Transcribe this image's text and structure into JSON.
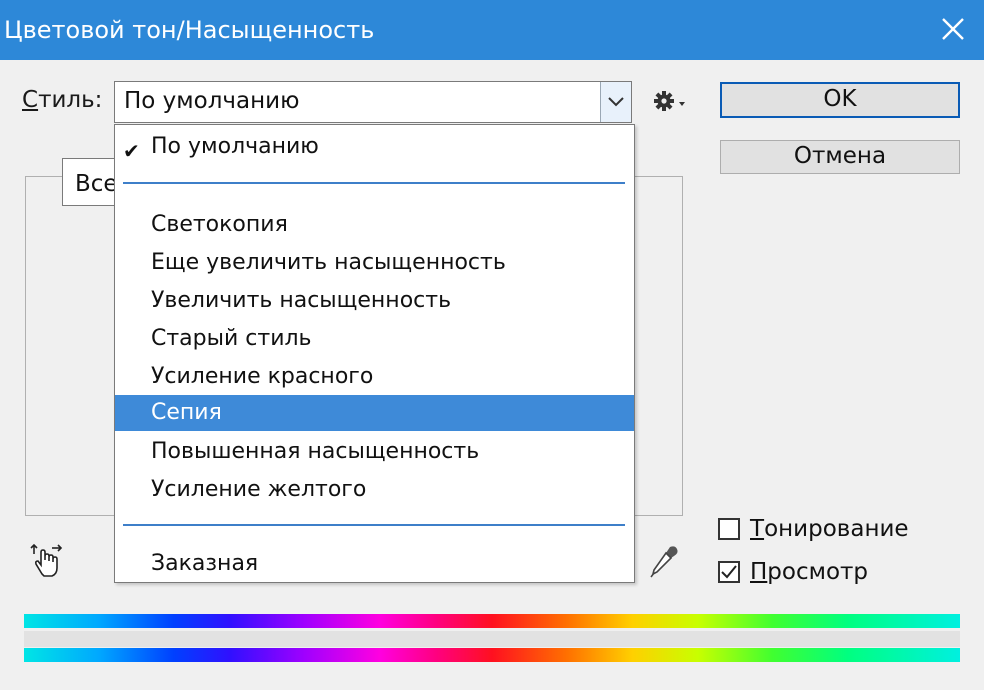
{
  "window": {
    "title": "Цветовой тон/Насыщенность",
    "titlebar_color": "#2d88d8"
  },
  "style": {
    "label_first_letter": "С",
    "label_rest": "тиль:",
    "selected_value": "По умолчанию"
  },
  "dropdown": {
    "checked_item": "По умолчанию",
    "items": [
      "Светокопия",
      "Еще увеличить насыщенность",
      "Увеличить насыщенность",
      "Старый стиль",
      "Усиление красного",
      "Сепия",
      "Повышенная насыщенность",
      "Усиление желтого"
    ],
    "highlighted_item": "Сепия",
    "custom_item": "Заказная",
    "highlight_color": "#3e8ad8"
  },
  "channel": {
    "visible_text": "Все"
  },
  "buttons": {
    "ok": "OK",
    "cancel": "Отмена"
  },
  "options": {
    "colorize_first_letter": "Т",
    "colorize_rest": "онирование",
    "colorize_checked": false,
    "preview_first_letter": "П",
    "preview_rest": "росмотр",
    "preview_checked": true
  },
  "icons": {
    "close": "close-icon",
    "dropdown_arrow": "chevron-down-icon",
    "gear": "gear-icon",
    "hand": "hand-adjust-icon",
    "eyedropper": "eyedropper-icon",
    "check": "checkmark-icon"
  }
}
